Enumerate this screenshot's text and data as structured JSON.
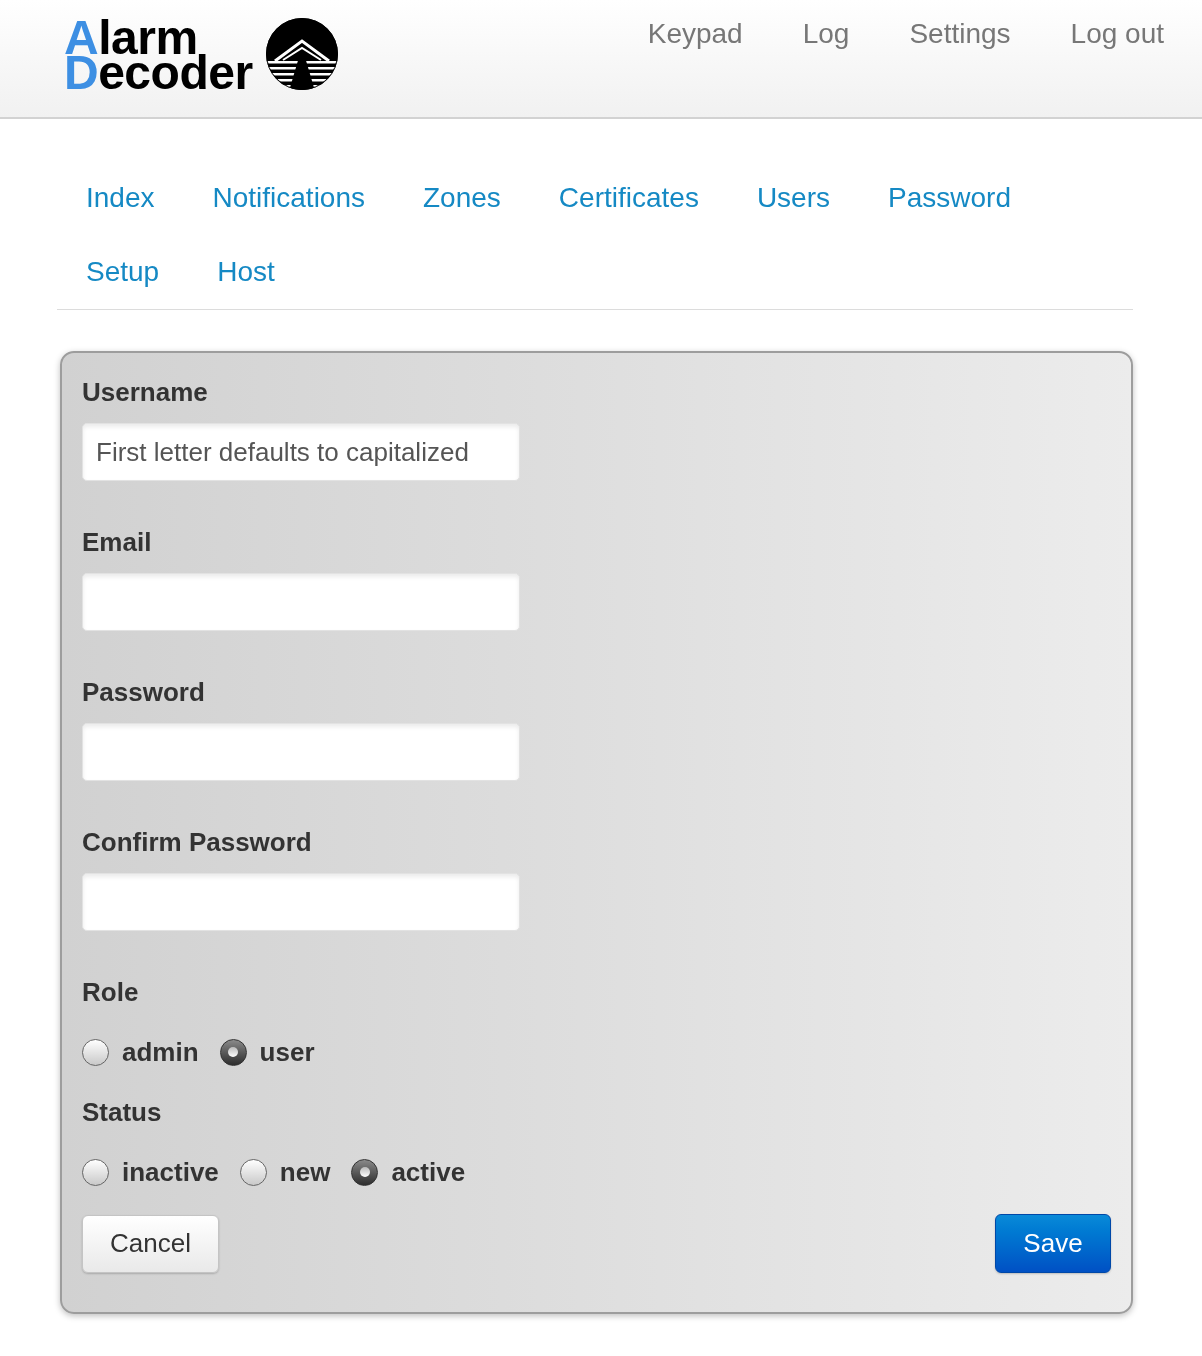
{
  "header": {
    "logo": {
      "lines": [
        "Alarm",
        "Decoder"
      ]
    },
    "nav": [
      {
        "label": "Keypad"
      },
      {
        "label": "Log"
      },
      {
        "label": "Settings"
      },
      {
        "label": "Log out"
      }
    ]
  },
  "tabs": [
    {
      "label": "Index"
    },
    {
      "label": "Notifications"
    },
    {
      "label": "Zones"
    },
    {
      "label": "Certificates"
    },
    {
      "label": "Users"
    },
    {
      "label": "Password"
    },
    {
      "label": "Setup"
    },
    {
      "label": "Host"
    }
  ],
  "form": {
    "fields": [
      {
        "label": "Username",
        "placeholder": "First letter defaults to capitalized"
      },
      {
        "label": "Email"
      },
      {
        "label": "Password"
      },
      {
        "label": "Confirm Password"
      }
    ],
    "radio_groups": [
      {
        "label": "Role",
        "options": [
          {
            "label": "admin",
            "selected": false
          },
          {
            "label": "user",
            "selected": true
          }
        ]
      },
      {
        "label": "Status",
        "options": [
          {
            "label": "inactive",
            "selected": false
          },
          {
            "label": "new",
            "selected": false
          },
          {
            "label": "active",
            "selected": true
          }
        ]
      }
    ],
    "buttons": [
      {
        "label": "Cancel",
        "kind": "default"
      },
      {
        "label": "Save",
        "kind": "primary"
      }
    ]
  }
}
